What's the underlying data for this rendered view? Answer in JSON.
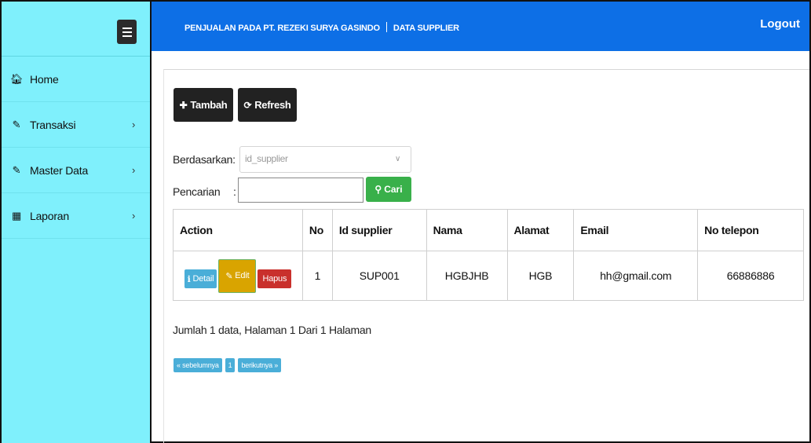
{
  "header": {
    "app_title": "PENJUALAN PADA PT. REZEKI SURYA GASINDO",
    "page_title": "DATA SUPPLIER",
    "logout_label": "Logout"
  },
  "sidebar": {
    "items": [
      {
        "label": "Home",
        "icon": "home-icon"
      },
      {
        "label": "Transaksi",
        "icon": "pencil-icon"
      },
      {
        "label": "Master Data",
        "icon": "edit-icon"
      },
      {
        "label": "Laporan",
        "icon": "calendar-icon"
      }
    ],
    "chevron": "›"
  },
  "toolbar": {
    "add_label": "Tambah",
    "refresh_label": "Refresh"
  },
  "filter": {
    "by_label": "Berdasarkan:",
    "by_value": "id_supplier",
    "search_label": "Pencarian",
    "search_colon": ":",
    "search_value": "",
    "search_button": "Cari"
  },
  "table": {
    "columns": [
      "Action",
      "No",
      "Id supplier",
      "Nama",
      "Alamat",
      "Email",
      "No telepon"
    ],
    "rows": [
      {
        "no": "1",
        "id_supplier": "SUP001",
        "nama": "HGBJHB",
        "alamat": "HGB",
        "email": "hh@gmail.com",
        "telepon": "66886886"
      }
    ],
    "actions": {
      "detail": "Detail",
      "edit": "Edit",
      "delete": "Hapus"
    }
  },
  "summary": "Jumlah 1 data, Halaman 1 Dari 1 Halaman",
  "pager": {
    "prev": "« sebelumnya",
    "current": "1",
    "next": "berikutnya »"
  },
  "colors": {
    "sidebar_bg": "#7ff0fc",
    "header_bg": "#0d6fe6",
    "info": "#4aaed8",
    "warning": "#d9a400",
    "danger": "#c9302c",
    "success": "#39b04a"
  }
}
